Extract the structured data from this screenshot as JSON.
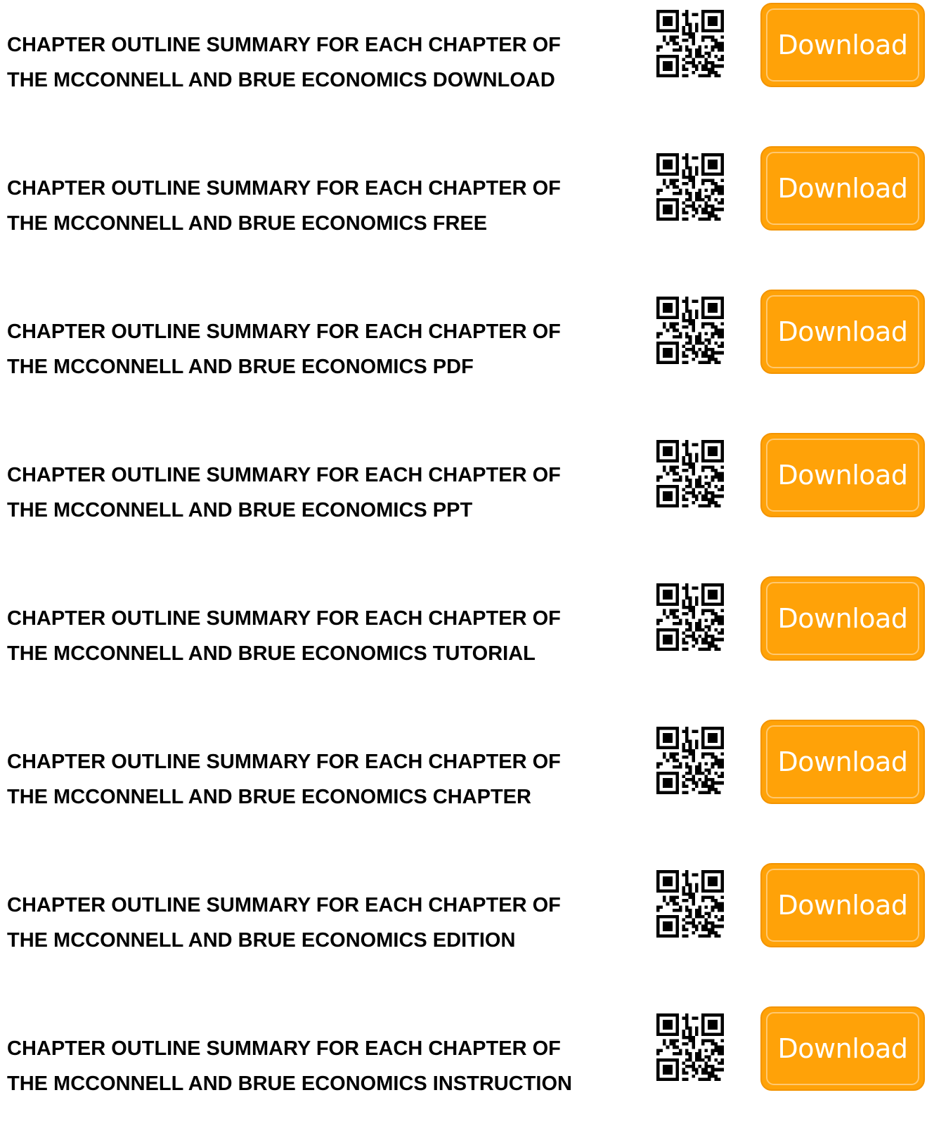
{
  "entries": [
    {
      "line1": "CHAPTER OUTLINE SUMMARY FOR EACH CHAPTER OF",
      "line2": "THE MCCONNELL AND BRUE ECONOMICS DOWNLOAD",
      "button": "Download"
    },
    {
      "line1": "CHAPTER OUTLINE SUMMARY FOR EACH CHAPTER OF",
      "line2": "THE MCCONNELL AND BRUE ECONOMICS FREE",
      "button": "Download"
    },
    {
      "line1": "CHAPTER OUTLINE SUMMARY FOR EACH CHAPTER OF",
      "line2": "THE MCCONNELL AND BRUE ECONOMICS PDF",
      "button": "Download"
    },
    {
      "line1": "CHAPTER OUTLINE SUMMARY FOR EACH CHAPTER OF",
      "line2": "THE MCCONNELL AND BRUE ECONOMICS PPT",
      "button": "Download"
    },
    {
      "line1": "CHAPTER OUTLINE SUMMARY FOR EACH CHAPTER OF",
      "line2": "THE MCCONNELL AND BRUE ECONOMICS TUTORIAL",
      "button": "Download"
    },
    {
      "line1": "CHAPTER OUTLINE SUMMARY FOR EACH CHAPTER OF",
      "line2": "THE MCCONNELL AND BRUE ECONOMICS CHAPTER",
      "button": "Download"
    },
    {
      "line1": "CHAPTER OUTLINE SUMMARY FOR EACH CHAPTER OF",
      "line2": "THE MCCONNELL AND BRUE ECONOMICS EDITION",
      "button": "Download"
    },
    {
      "line1": "CHAPTER OUTLINE SUMMARY FOR EACH CHAPTER OF",
      "line2": "THE MCCONNELL AND BRUE ECONOMICS INSTRUCTION",
      "button": "Download"
    }
  ],
  "icons": {
    "qr": "qr-code-icon"
  },
  "colors": {
    "button_fill": "#ffa208",
    "button_border": "#f39400",
    "button_inner_border": "#ffc870",
    "button_text": "#ffffff",
    "title_text": "#000000"
  }
}
